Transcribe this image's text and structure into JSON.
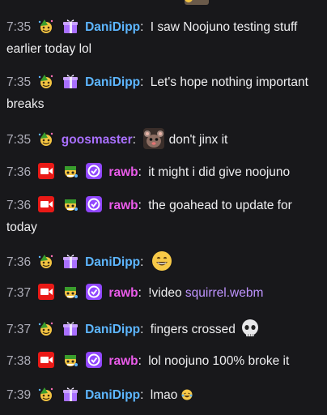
{
  "colors": {
    "background": "#18181b",
    "text": "#efeff1",
    "timestamp": "#adadb8",
    "DaniDipp": "#5db6ff",
    "goosmaster": "#a970ff",
    "rawb": "#ea5bea",
    "link": "#bf94ff"
  },
  "icons": {
    "party": "party-hat-emoji-badge-icon",
    "gift": "gift-badge-icon",
    "broadcaster": "broadcaster-camera-badge-icon",
    "bot": "bot-badge-icon",
    "verified": "verified-check-badge-icon"
  },
  "messages": [
    {
      "time": "7:35",
      "user": "DaniDipp",
      "text": "I saw Noojuno testing stuff earlier today lol"
    },
    {
      "time": "7:35",
      "user": "DaniDipp",
      "text": "Let's hope nothing important breaks"
    },
    {
      "time": "7:35",
      "user": "goosmaster",
      "text": "don't jinx it"
    },
    {
      "time": "7:36",
      "user": "rawb",
      "text": "it might i did give noojuno"
    },
    {
      "time": "7:36",
      "user": "rawb",
      "text": "the goahead to update for today"
    },
    {
      "time": "7:36",
      "user": "DaniDipp",
      "text": ""
    },
    {
      "time": "7:37",
      "user": "rawb",
      "text": "!video ",
      "link": "squirrel.webm"
    },
    {
      "time": "7:37",
      "user": "DaniDipp",
      "text": "fingers crossed"
    },
    {
      "time": "7:38",
      "user": "rawb",
      "text": "lol noojuno 100% broke it"
    },
    {
      "time": "7:39",
      "user": "DaniDipp",
      "text": "lmao"
    }
  ]
}
